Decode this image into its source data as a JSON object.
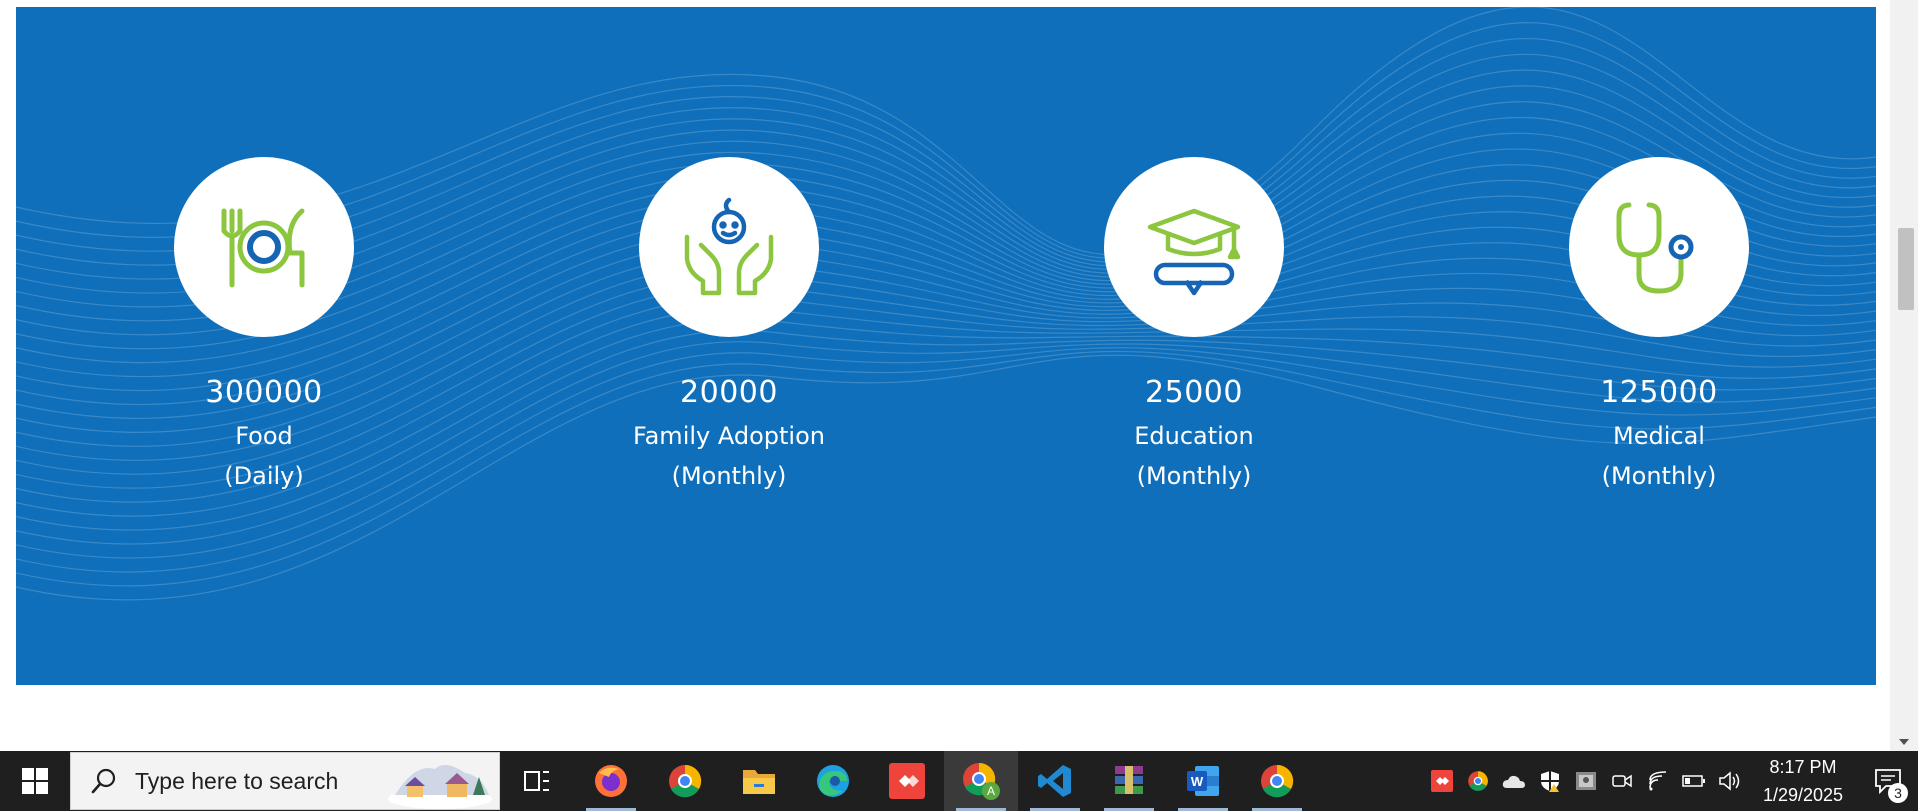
{
  "stats": [
    {
      "icon": "plate-cutlery-icon",
      "count": "300000",
      "label": "Food",
      "period": "(Daily)"
    },
    {
      "icon": "baby-hands-icon",
      "count": "20000",
      "label": "Family Adoption",
      "period": "(Monthly)"
    },
    {
      "icon": "graduation-cap-icon",
      "count": "25000",
      "label": "Education",
      "period": "(Monthly)"
    },
    {
      "icon": "stethoscope-icon",
      "count": "125000",
      "label": "Medical",
      "period": "(Monthly)"
    }
  ],
  "colors": {
    "banner_blue": "#0f6fbb",
    "icon_green": "#8cc63f",
    "icon_blue": "#1565b4",
    "taskbar": "#1f1f1f"
  },
  "taskbar": {
    "search_placeholder": "Type here to search",
    "apps": [
      "task-view-icon",
      "firefox-icon",
      "chrome-icon",
      "file-explorer-icon",
      "edge-icon",
      "anydesk-icon",
      "chrome-profile-icon",
      "vscode-icon",
      "winrar-icon",
      "word-icon",
      "chrome-icon"
    ],
    "tray": [
      "anydesk-tray-icon",
      "chrome-tray-icon",
      "onedrive-icon",
      "security-icon",
      "display-icon",
      "meet-icon",
      "wifi-icon",
      "battery-icon",
      "volume-icon"
    ],
    "time": "8:17 PM",
    "date": "1/29/2025",
    "notification_count": "3"
  }
}
